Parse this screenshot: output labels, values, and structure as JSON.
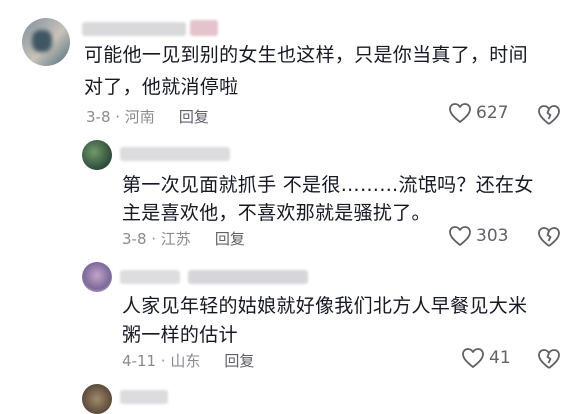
{
  "comments": [
    {
      "level": "top",
      "lines": [
        "可能他一见到别的女生也这样，只是你当真了，时间",
        "对了，他就消停啦"
      ],
      "date_location": "3-8 · 河南",
      "reply_label": "回复",
      "likes": "627"
    },
    {
      "level": "reply",
      "lines": [
        "第一次见面就抓手 不是很………流氓吗？还在女",
        "主是喜欢他，不喜欢那就是骚扰了。"
      ],
      "date_location": "3-8 · 江苏",
      "reply_label": "回复",
      "likes": "303"
    },
    {
      "level": "reply",
      "lines": [
        "人家见年轻的姑娘就好像我们北方人早餐见大米",
        "粥一样的估计"
      ],
      "date_location": "4-11 · 山东",
      "reply_label": "回复",
      "likes": "41"
    }
  ],
  "colors": {
    "text": "#161823",
    "meta": "#8a8b91",
    "icon": "#5f6068"
  },
  "icons": [
    "heart-icon",
    "broken-heart-icon"
  ]
}
